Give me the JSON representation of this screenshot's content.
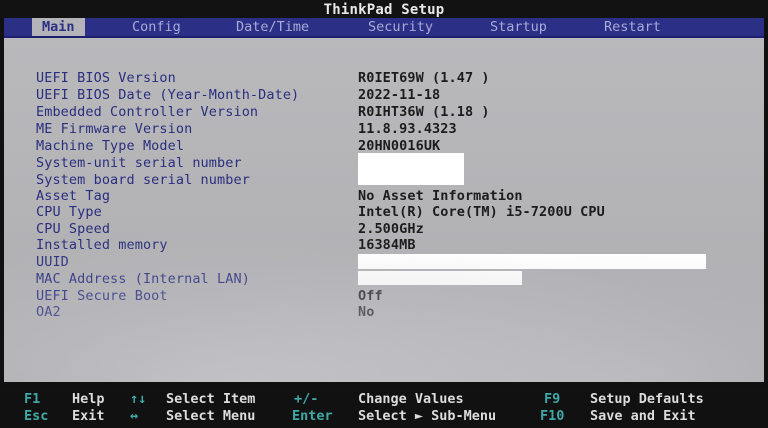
{
  "title": "ThinkPad Setup",
  "tabs": [
    {
      "label": "Main",
      "active": true
    },
    {
      "label": "Config",
      "active": false
    },
    {
      "label": "Date/Time",
      "active": false
    },
    {
      "label": "Security",
      "active": false
    },
    {
      "label": "Startup",
      "active": false
    },
    {
      "label": "Restart",
      "active": false
    }
  ],
  "rows": [
    {
      "label": "UEFI BIOS Version",
      "value": "R0IET69W (1.47 )"
    },
    {
      "label": "UEFI BIOS Date (Year-Month-Date)",
      "value": "2022-11-18"
    },
    {
      "label": "Embedded Controller Version",
      "value": "R0IHT36W (1.18 )"
    },
    {
      "label": "ME Firmware Version",
      "value": "11.8.93.4323"
    },
    {
      "label": "Machine Type Model",
      "value": "20HN0016UK"
    },
    {
      "label": "System-unit serial number",
      "value": ""
    },
    {
      "label": "System board serial number",
      "value": ""
    },
    {
      "label": "Asset Tag",
      "value": "No Asset Information"
    },
    {
      "label": "CPU Type",
      "value": "Intel(R) Core(TM) i5-7200U CPU"
    },
    {
      "label": "CPU Speed",
      "value": "2.500GHz"
    },
    {
      "label": "Installed memory",
      "value": "16384MB"
    },
    {
      "label": "UUID",
      "value": ""
    },
    {
      "label": "MAC Address (Internal LAN)",
      "value": ""
    },
    {
      "label": "UEFI Secure Boot",
      "value": "Off"
    },
    {
      "label": "OA2",
      "value": "No"
    }
  ],
  "footer": {
    "row1": [
      {
        "key": "F1",
        "desc": "Help"
      },
      {
        "key": "↑↓",
        "desc": "Select Item"
      },
      {
        "key": "+/-",
        "desc": "Change Values"
      },
      {
        "key": "F9",
        "desc": "Setup Defaults"
      }
    ],
    "row2": [
      {
        "key": "Esc",
        "desc": "Exit"
      },
      {
        "key": "↔",
        "desc": "Select Menu"
      },
      {
        "key": "Enter",
        "desc": "Select ► Sub-Menu"
      },
      {
        "key": "F10",
        "desc": "Save and Exit"
      }
    ]
  },
  "colors": {
    "menu_bar": "#2b2f86",
    "active_tab_bg": "#b4b4b8",
    "label_text": "#2a2e7e",
    "value_text": "#1c1c1c",
    "footer_key": "#3fa9a7",
    "footer_desc": "#dcdcdc"
  }
}
